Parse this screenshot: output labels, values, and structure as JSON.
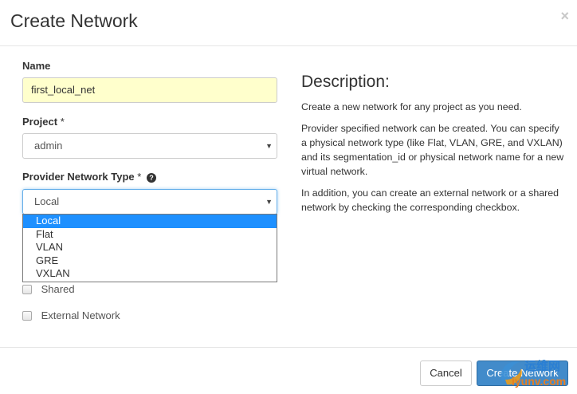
{
  "modal": {
    "title": "Create Network",
    "close_glyph": "×"
  },
  "form": {
    "name_label": "Name",
    "name_value": "first_local_net",
    "project_label": "Project",
    "required_marker": "*",
    "project_value": "admin",
    "provider_label": "Provider Network Type",
    "help_glyph": "?",
    "provider_value": "Local",
    "provider_options": [
      "Local",
      "Flat",
      "VLAN",
      "GRE",
      "VXLAN"
    ],
    "shared_label": "Shared",
    "external_label": "External Network"
  },
  "description": {
    "title": "Description:",
    "paragraphs": [
      "Create a new network for any project as you need.",
      "Provider specified network can be created. You can specify a physical network type (like Flat, VLAN, GRE, and VXLAN) and its segmentation_id or physical network name for a new virtual network.",
      "In addition, you can create an external network or a shared network by checking the corresponding checkbox."
    ]
  },
  "footer": {
    "cancel_label": "Cancel",
    "create_label": "Create Network"
  },
  "watermark": {
    "line1": "运维网",
    "line2": "iyunv.com"
  },
  "icons": {
    "select_caret": "caret-down-icon",
    "help": "question-circle-icon"
  },
  "colors": {
    "primary": "#428bca",
    "selected_option": "#1e90ff",
    "autofill_bg": "#ffffcc"
  }
}
